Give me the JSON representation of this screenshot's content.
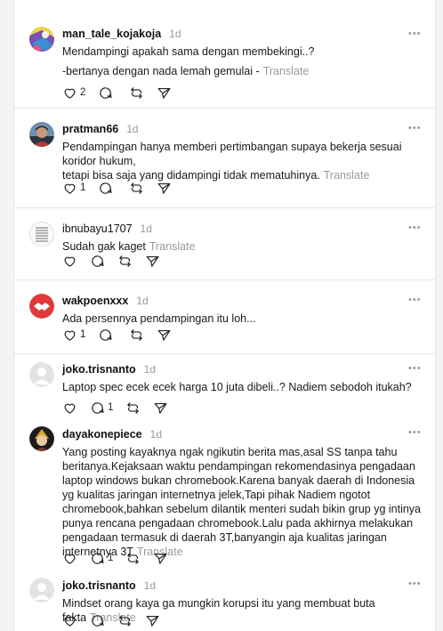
{
  "posts": [
    {
      "username": "man_tale_kojakoja",
      "time": "1d",
      "lines": [
        "Mendampingi apakah sama dengan membekingi..?",
        "-bertanya dengan nada lemah gemulai -"
      ],
      "translate": "Translate",
      "likes": "2",
      "replies": "",
      "avatar_icon": "colorful-painting-avatar"
    },
    {
      "username": "pratman66",
      "time": "1d",
      "lines": [
        "Pendampingan hanya memberi pertimbangan supaya bekerja sesuai koridor hukum,\ntetapi bisa saja yang didampingi tidak mematuhinya."
      ],
      "translate": "Translate",
      "likes": "1",
      "replies": "",
      "avatar_icon": "person-photo-avatar"
    },
    {
      "username": "ibnubayu1707",
      "time": "1d",
      "lines": [
        "Sudah gak kaget"
      ],
      "translate": "Translate",
      "likes": "",
      "replies": "",
      "avatar_icon": "striped-pattern-avatar"
    },
    {
      "username": "wakpoenxxx",
      "time": "1d",
      "lines": [
        "Ada persennya pendampingan itu loh..."
      ],
      "translate": "",
      "likes": "1",
      "replies": "",
      "avatar_icon": "handshake-logo-avatar"
    },
    {
      "username": "joko.trisnanto",
      "time": "1d",
      "lines": [
        "Laptop spec ecek ecek harga 10 juta dibeli..? Nadiem sebodoh itukah?"
      ],
      "translate": "",
      "likes": "",
      "replies": "1",
      "avatar_icon": "default-user-avatar"
    },
    {
      "username": "dayakonepiece",
      "time": "1d",
      "lines": [
        "Yang posting kayaknya ngak ngikutin berita mas,asal SS tanpa tahu beritanya.Kejaksaan waktu pendampingan rekomendasinya pengadaan laptop windows bukan chromebook.Karena banyak daerah di Indonesia yg kualitas jaringan internetnya jelek,Tapi pihak Nadiem ngotot chromebook,bahkan sebelum dilantik menteri sudah bikin grup yg intinya punya rencana pengadaan chromebook.Lalu pada akhirnya melakukan pengadaan termasuk di daerah 3T,banyangin aja kualitas jaringan internetnya 3T"
      ],
      "translate": "Translate",
      "likes": "",
      "replies": "1",
      "avatar_icon": "anime-character-avatar"
    },
    {
      "username": "joko.trisnanto",
      "time": "1d",
      "lines": [
        "Mindset orang kaya ga mungkin korupsi itu yang membuat buta fakta"
      ],
      "translate": "Translate",
      "likes": "",
      "replies": "",
      "avatar_icon": "default-user-avatar"
    }
  ],
  "icons": {
    "like": "heart-icon",
    "reply": "comment-icon",
    "repost": "repost-icon",
    "share": "send-icon",
    "more": "more-options-icon"
  }
}
